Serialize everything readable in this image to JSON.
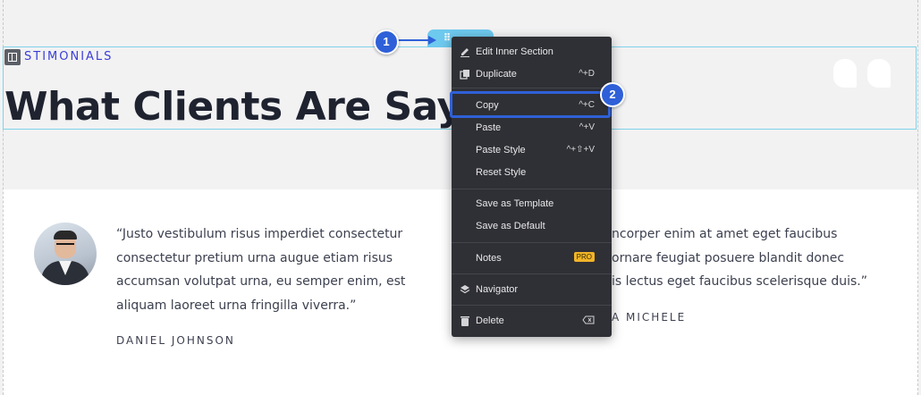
{
  "section": {
    "eyebrow": "STIMONIALS",
    "headline": "What Clients Are Saying"
  },
  "toolbar": {
    "handle_glyph": "⠿"
  },
  "context_menu": {
    "items": [
      {
        "label": "Edit Inner Section",
        "shortcut": "",
        "icon": "pencil-icon"
      },
      {
        "label": "Duplicate",
        "shortcut": "^+D",
        "icon": "duplicate-icon"
      },
      {
        "label": "Copy",
        "shortcut": "^+C",
        "icon": ""
      },
      {
        "label": "Paste",
        "shortcut": "^+V",
        "icon": ""
      },
      {
        "label": "Paste Style",
        "shortcut": "^+⇧+V",
        "icon": ""
      },
      {
        "label": "Reset Style",
        "shortcut": "",
        "icon": ""
      },
      {
        "label": "Save as Template",
        "shortcut": "",
        "icon": ""
      },
      {
        "label": "Save as Default",
        "shortcut": "",
        "icon": ""
      },
      {
        "label": "Notes",
        "shortcut": "",
        "badge": "PRO",
        "icon": ""
      },
      {
        "label": "Navigator",
        "shortcut": "",
        "icon": "layers-icon"
      },
      {
        "label": "Delete",
        "shortcut": "",
        "icon": "trash-icon"
      }
    ]
  },
  "markers": [
    "1",
    "2"
  ],
  "testimonials": [
    {
      "quote_lines": [
        "“Justo vestibulum risus imperdiet consectetur",
        "consectetur pretium urna augue etiam risus",
        "accumsan volutpat urna, eu semper enim, est",
        "aliquam laoreet urna fringilla viverra.”"
      ],
      "name": "DANIEL JOHNSON"
    },
    {
      "quote_lines": [
        "ncorper enim at amet eget faucibus",
        "ornare feugiat posuere blandit donec",
        "is lectus eget faucibus scelerisque duis.”"
      ],
      "name": "A MICHELE"
    }
  ]
}
